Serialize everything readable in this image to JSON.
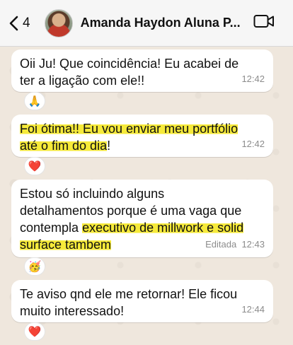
{
  "header": {
    "back_count": "4",
    "contact_name": "Amanda Haydon Aluna P..."
  },
  "messages": [
    {
      "lines": [
        "Oii Ju! Que coincidência! Eu acabei de",
        "ter a ligação com ele!!"
      ],
      "time": "12:42",
      "reaction": "🙏"
    },
    {
      "lines_hl": [
        "Foi ótima!! Eu vou enviar meu portfólio",
        "até o fim do dia"
      ],
      "trailing": "!",
      "time": "12:42",
      "reaction": "❤️"
    },
    {
      "line1": "Estou só incluindo alguns",
      "line2": "detalhamentos porque é uma vaga que",
      "line3_plain": "contempla ",
      "line3_hl": "executivo de millwork e solid",
      "line4_hl": "surface tambem",
      "edited": "Editada",
      "time": "12:43",
      "reaction": "🥳"
    },
    {
      "lines": [
        "Te aviso qnd ele me retornar! Ele ficou",
        "muito interessado!"
      ],
      "time": "12:44",
      "reaction": "❤️"
    }
  ]
}
